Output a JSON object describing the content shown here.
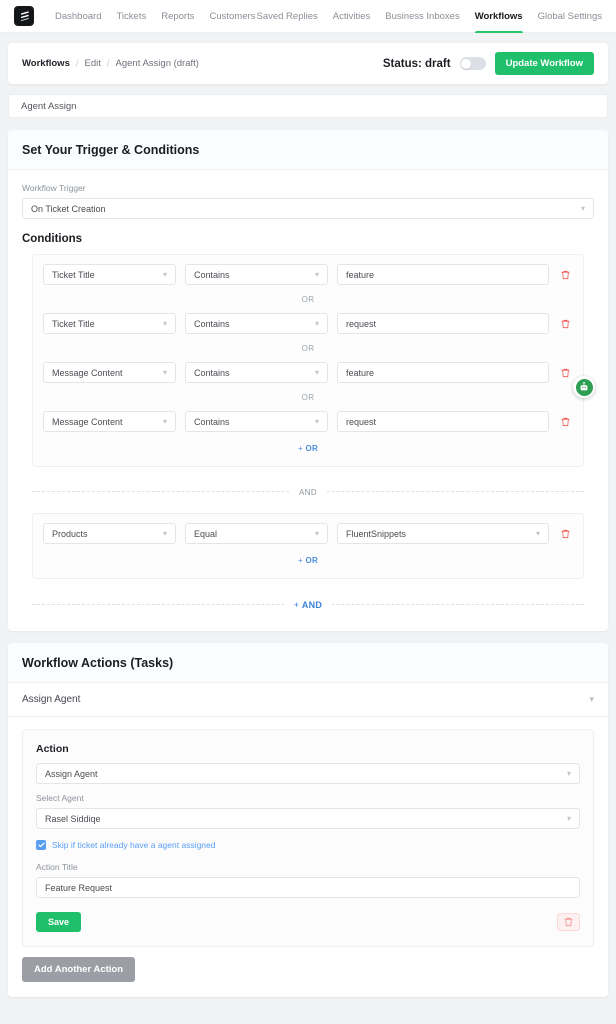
{
  "nav": {
    "logo_icon": "fluent-support-logo-icon",
    "left_items": [
      {
        "label": "Dashboard",
        "active": false
      },
      {
        "label": "Tickets",
        "active": false
      },
      {
        "label": "Reports",
        "active": false
      },
      {
        "label": "Customers",
        "active": false
      }
    ],
    "right_items": [
      {
        "label": "Saved Replies",
        "active": false
      },
      {
        "label": "Activities",
        "active": false
      },
      {
        "label": "Business Inboxes",
        "active": false
      },
      {
        "label": "Workflows",
        "active": true
      },
      {
        "label": "Global Settings",
        "active": false
      }
    ],
    "active_accent": "#28c76f"
  },
  "breadcrumb": {
    "root": "Workflows",
    "sep": "/",
    "middle": "Edit",
    "current": "Agent Assign (draft)",
    "status_label": "Status: draft",
    "toggle_on": false,
    "update_button": "Update Workflow",
    "update_button_color": "#20bf6b"
  },
  "workflow_title": {
    "value": "Agent Assign",
    "placeholder": "Workflow Title"
  },
  "trigger_panel": {
    "heading": "Set Your Trigger & Conditions",
    "trigger_label": "Workflow Trigger",
    "trigger_value": "On Ticket Creation",
    "conditions_heading": "Conditions",
    "or_separator": "OR",
    "and_separator": "AND",
    "add_or_label": "OR",
    "add_and_label": "AND",
    "add_prefix": "+",
    "add_or_color": "#4a90e2",
    "add_and_color": "#3b82d6",
    "groups": [
      {
        "rows": [
          {
            "field": "Ticket Title",
            "operator": "Contains",
            "value": "feature",
            "value_is_select": false
          },
          {
            "field": "Ticket Title",
            "operator": "Contains",
            "value": "request",
            "value_is_select": false
          },
          {
            "field": "Message Content",
            "operator": "Contains",
            "value": "feature",
            "value_is_select": false
          },
          {
            "field": "Message Content",
            "operator": "Contains",
            "value": "request",
            "value_is_select": false
          }
        ]
      },
      {
        "rows": [
          {
            "field": "Products",
            "operator": "Equal",
            "value": "FluentSnippets",
            "value_is_select": true
          }
        ]
      }
    ],
    "delete_icon": "trash-icon"
  },
  "actions_panel": {
    "heading": "Workflow Actions (Tasks)",
    "accordion_title": "Assign Agent",
    "accordion_chevron_icon": "chevron-down-icon",
    "action_label": "Action",
    "action_value": "Assign Agent",
    "agent_label": "Select Agent",
    "agent_value": "Rasel Siddiqe",
    "skip_checkbox_label": "Skip if ticket already have a agent assigned",
    "skip_checked": true,
    "skip_color": "#5a9ef2",
    "action_title_label": "Action Title",
    "action_title_value": "Feature Request",
    "save_label": "Save",
    "save_color": "#20bf6b",
    "delete_icon": "trash-icon",
    "add_action_label": "Add Another Action",
    "add_action_color": "#9b9ea4"
  },
  "floating_widget": {
    "icon": "support-bot-icon",
    "color": "#2e9e52"
  }
}
